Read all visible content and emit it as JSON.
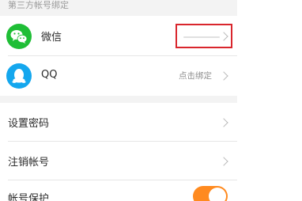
{
  "section_title": "第三方帐号绑定",
  "bindings": [
    {
      "label": "微信",
      "icon": "wechat-icon",
      "value": "",
      "value_masked": true
    },
    {
      "label": "QQ",
      "icon": "qq-icon",
      "value": "点击绑定"
    }
  ],
  "settings": [
    {
      "label": "设置密码"
    },
    {
      "label": "注销帐号"
    },
    {
      "label": "帐号保护",
      "toggle_on": true
    }
  ],
  "colors": {
    "wechat": "#1fbe36",
    "qq": "#14a7ee",
    "toggle_on": "#ff8a1f",
    "highlight": "#d9262d"
  }
}
